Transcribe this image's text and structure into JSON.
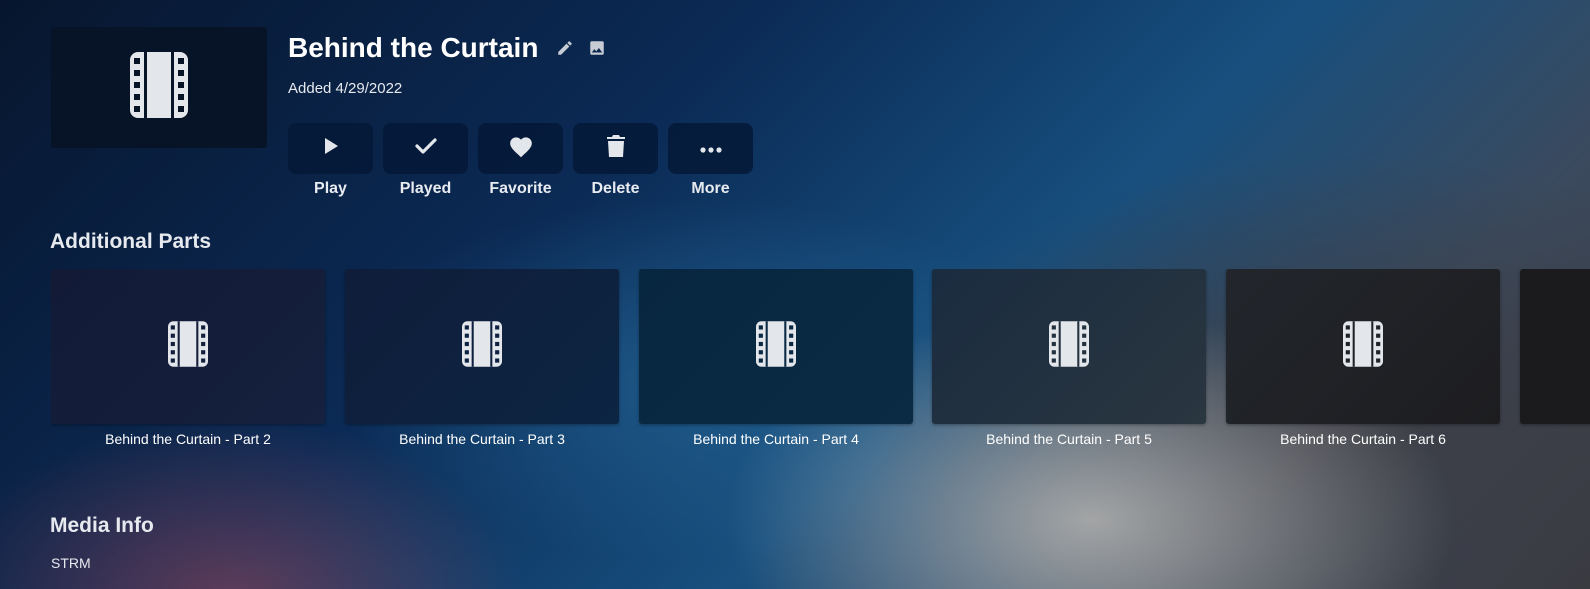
{
  "item": {
    "title": "Behind the Curtain",
    "added": "Added 4/29/2022",
    "poster_icon": "film-icon"
  },
  "title_icons": [
    "edit-icon",
    "image-icon"
  ],
  "actions": [
    {
      "label": "Play",
      "icon": "play-icon"
    },
    {
      "label": "Played",
      "icon": "check-icon"
    },
    {
      "label": "Favorite",
      "icon": "heart-icon"
    },
    {
      "label": "Delete",
      "icon": "trash-icon"
    },
    {
      "label": "More",
      "icon": "more-horizontal-icon"
    }
  ],
  "additional_parts": {
    "heading": "Additional Parts",
    "items": [
      {
        "title": "Behind the Curtain - Part 2"
      },
      {
        "title": "Behind the Curtain - Part 3"
      },
      {
        "title": "Behind the Curtain - Part 4"
      },
      {
        "title": "Behind the Curtain - Part 5"
      },
      {
        "title": "Behind the Curtain - Part 6"
      }
    ]
  },
  "media_info": {
    "heading": "Media Info",
    "container": "STRM"
  },
  "colors": {
    "button_bg": "#06193a",
    "icon": "#e3e6ea",
    "text": "#ffffff"
  }
}
